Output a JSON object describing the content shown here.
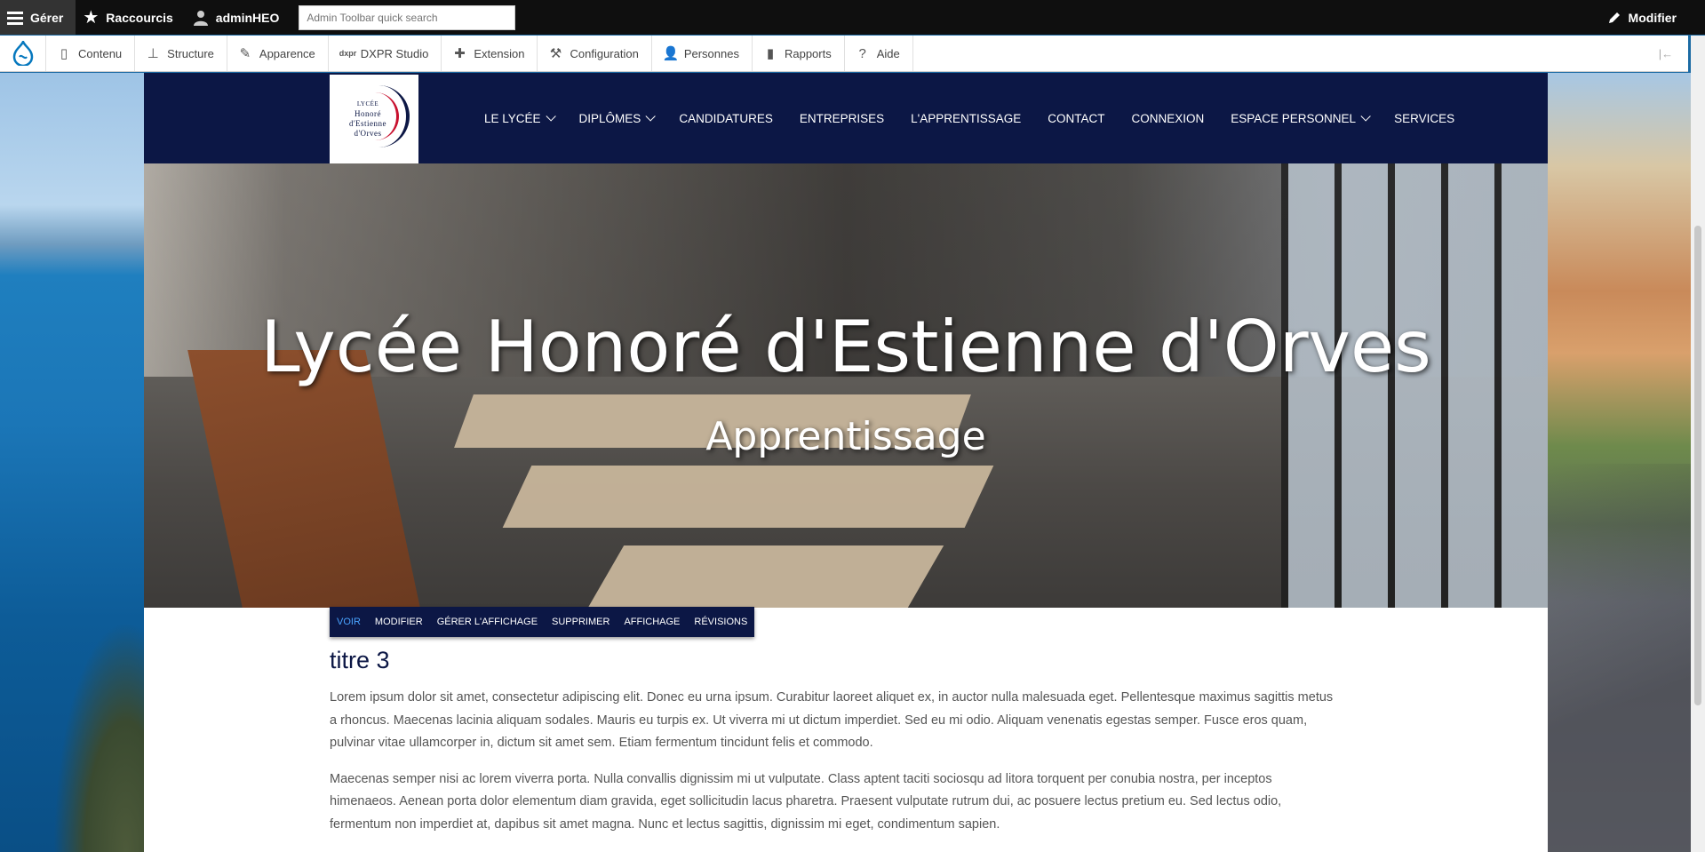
{
  "admin_toolbar": {
    "manage_label": "Gérer",
    "shortcuts_label": "Raccourcis",
    "user_label": "adminHEO",
    "search_placeholder": "Admin Toolbar quick search",
    "edit_label": "Modifier"
  },
  "admin_tray": {
    "items": [
      {
        "label": "Contenu",
        "icon": "file-icon"
      },
      {
        "label": "Structure",
        "icon": "sitemap-icon"
      },
      {
        "label": "Apparence",
        "icon": "paintbrush-icon"
      },
      {
        "label": "DXPR Studio",
        "icon": "dxpr-icon"
      },
      {
        "label": "Extension",
        "icon": "puzzle-icon"
      },
      {
        "label": "Configuration",
        "icon": "wrench-icon"
      },
      {
        "label": "Personnes",
        "icon": "people-icon"
      },
      {
        "label": "Rapports",
        "icon": "bar-chart-icon"
      },
      {
        "label": "Aide",
        "icon": "help-icon"
      }
    ]
  },
  "site": {
    "logo_lines": [
      "LYCÉE",
      "Honoré",
      "d'Estienne",
      "d'Orves"
    ],
    "nav": [
      {
        "label": "LE LYCÉE",
        "dropdown": true
      },
      {
        "label": "DIPLÔMES",
        "dropdown": true
      },
      {
        "label": "CANDIDATURES",
        "dropdown": false
      },
      {
        "label": "ENTREPRISES",
        "dropdown": false
      },
      {
        "label": "L'APPRENTISSAGE",
        "dropdown": false
      },
      {
        "label": "CONTACT",
        "dropdown": false
      },
      {
        "label": "CONNEXION",
        "dropdown": false
      },
      {
        "label": "ESPACE PERSONNEL",
        "dropdown": true
      },
      {
        "label": "SERVICES",
        "dropdown": false
      }
    ],
    "hero": {
      "title": "Lycée Honoré d'Estienne d'Orves",
      "subtitle": "Apprentissage"
    },
    "tabs": [
      {
        "label": "VOIR",
        "active": true
      },
      {
        "label": "MODIFIER",
        "active": false
      },
      {
        "label": "GÉRER L'AFFICHAGE",
        "active": false
      },
      {
        "label": "SUPPRIMER",
        "active": false
      },
      {
        "label": "AFFICHAGE",
        "active": false
      },
      {
        "label": "RÉVISIONS",
        "active": false
      }
    ],
    "content": {
      "heading": "titre 3",
      "paragraphs": [
        "Lorem ipsum dolor sit amet, consectetur adipiscing elit. Donec eu urna ipsum. Curabitur laoreet aliquet ex, in auctor nulla malesuada eget. Pellentesque maximus sagittis metus a rhoncus. Maecenas lacinia aliquam sodales. Mauris eu turpis ex. Ut viverra mi ut dictum imperdiet. Sed eu mi odio. Aliquam venenatis egestas semper. Fusce eros quam, pulvinar vitae ullamcorper in, dictum sit amet sem. Etiam fermentum tincidunt felis et commodo.",
        "Maecenas semper nisi ac lorem viverra porta. Nulla convallis dignissim mi ut vulputate. Class aptent taciti sociosqu ad litora torquent per conubia nostra, per inceptos himenaeos. Aenean porta dolor elementum diam gravida, eget sollicitudin lacus pharetra. Praesent vulputate rutrum dui, ac posuere lectus pretium eu. Sed lectus odio, fermentum non imperdiet at, dapibus sit amet magna. Nunc et lectus sagittis, dignissim mi eget, condimentum sapien."
      ]
    }
  },
  "colors": {
    "toolbar_bg": "#0f0f0f",
    "header_bg": "#0c1745",
    "tab_active": "#4aa3ff",
    "drupal_blue": "#0678be"
  }
}
